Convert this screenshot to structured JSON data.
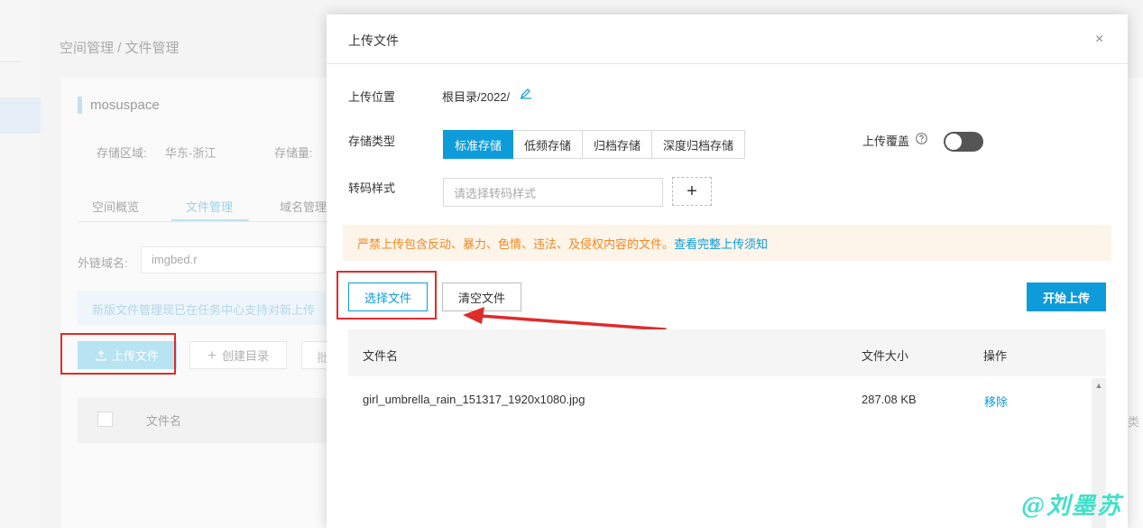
{
  "background": {
    "breadcrumb": "空间管理  /  文件管理",
    "space_name": "mosuspace",
    "region_label": "存储区域:",
    "region_value": "华东-浙江",
    "storage_label": "存储量:",
    "tabs": [
      "空间概览",
      "文件管理",
      "域名管理"
    ],
    "domain_label": "外链域名:",
    "domain_value": "imgbed.r",
    "notice": "新版文件管理现已在任务中心支持对新上传",
    "upload_button": "上传文件",
    "mkdir_button": "创建目录",
    "more_button": "批",
    "col_name": "文件名",
    "right_fragment": "类"
  },
  "modal": {
    "title": "上传文件",
    "close": "×",
    "location_label": "上传位置",
    "location_value": "根目录/2022/",
    "storage_type_label": "存储类型",
    "storage_types": [
      "标准存储",
      "低频存储",
      "归档存储",
      "深度归档存储"
    ],
    "storage_type_selected": "标准存储",
    "overwrite_label": "上传覆盖",
    "overwrite_enabled": false,
    "transcode_label": "转码样式",
    "transcode_placeholder": "请选择转码样式",
    "add_symbol": "+",
    "warning_text": "严禁上传包含反动、暴力、色情、违法、及侵权内容的文件。",
    "warning_link": "查看完整上传须知",
    "choose_button": "选择文件",
    "clear_button": "清空文件",
    "start_button": "开始上传",
    "table": {
      "headers": [
        "文件名",
        "文件大小",
        "操作"
      ],
      "rows": [
        {
          "name": "girl_umbrella_rain_151317_1920x1080.jpg",
          "size": "287.08 KB",
          "action": "移除"
        }
      ]
    }
  },
  "watermark": "@刘墨苏",
  "colors": {
    "accent": "#0e9bd9",
    "highlight": "#e02b2b",
    "warning": "#f08a24",
    "watermark": "#3fe0c9"
  }
}
